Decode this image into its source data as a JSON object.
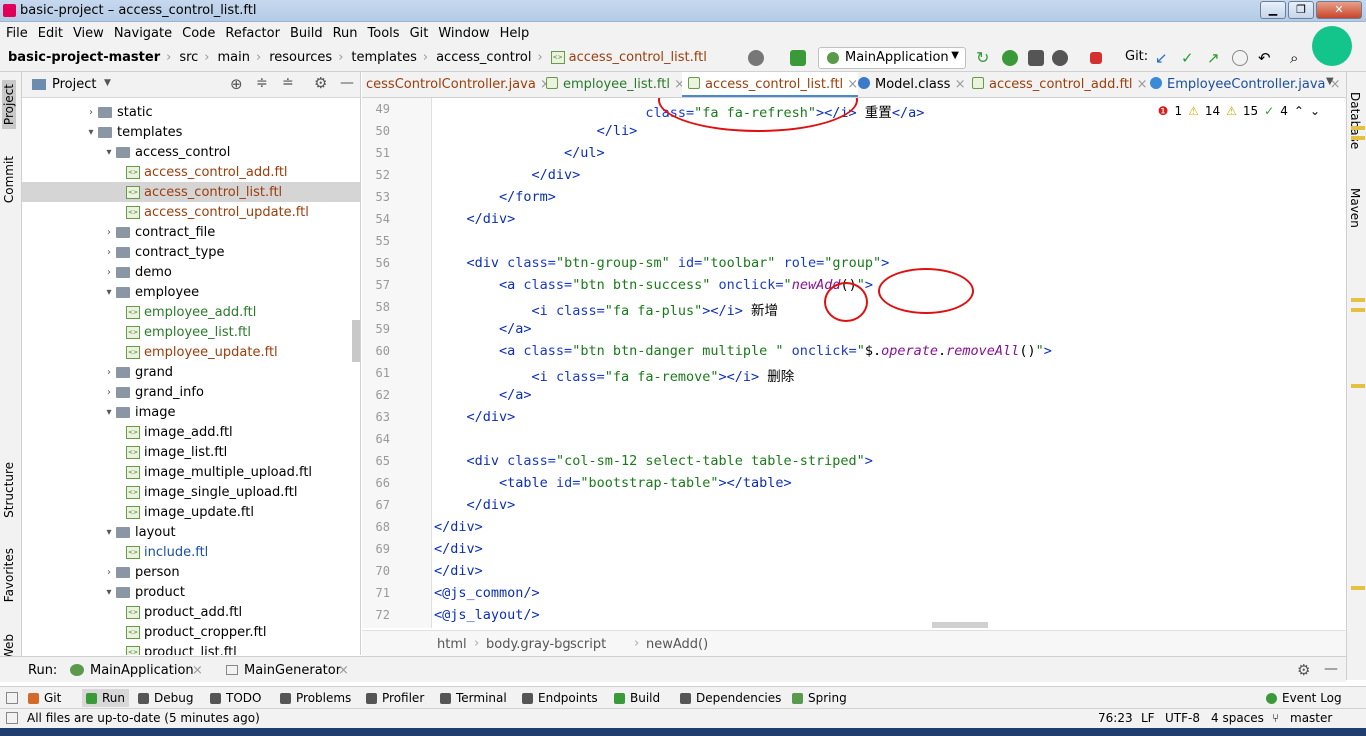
{
  "window": {
    "title": "basic-project – access_control_list.ftl"
  },
  "menu": [
    "File",
    "Edit",
    "View",
    "Navigate",
    "Code",
    "Refactor",
    "Build",
    "Run",
    "Tools",
    "Git",
    "Window",
    "Help"
  ],
  "breadcrumbs": [
    "basic-project-master",
    "src",
    "main",
    "resources",
    "templates",
    "access_control",
    "access_control_list.ftl"
  ],
  "toolbar": {
    "run_config": "MainApplication",
    "git_label": "Git:"
  },
  "project_panel": {
    "title": "Project",
    "tree": [
      {
        "label": "static",
        "type": "folder",
        "depth": 1,
        "expanded": false
      },
      {
        "label": "templates",
        "type": "folder",
        "depth": 1,
        "expanded": true
      },
      {
        "label": "access_control",
        "type": "folder",
        "depth": 2,
        "expanded": true
      },
      {
        "label": "access_control_add.ftl",
        "type": "file",
        "depth": 3,
        "color": "brown"
      },
      {
        "label": "access_control_list.ftl",
        "type": "file",
        "depth": 3,
        "color": "brown",
        "selected": true
      },
      {
        "label": "access_control_update.ftl",
        "type": "file",
        "depth": 3,
        "color": "brown"
      },
      {
        "label": "contract_file",
        "type": "folder",
        "depth": 2,
        "expanded": false
      },
      {
        "label": "contract_type",
        "type": "folder",
        "depth": 2,
        "expanded": false
      },
      {
        "label": "demo",
        "type": "folder",
        "depth": 2,
        "expanded": false
      },
      {
        "label": "employee",
        "type": "folder",
        "depth": 2,
        "expanded": true
      },
      {
        "label": "employee_add.ftl",
        "type": "file",
        "depth": 3,
        "color": "green"
      },
      {
        "label": "employee_list.ftl",
        "type": "file",
        "depth": 3,
        "color": "green"
      },
      {
        "label": "employee_update.ftl",
        "type": "file",
        "depth": 3,
        "color": "brown"
      },
      {
        "label": "grand",
        "type": "folder",
        "depth": 2,
        "expanded": false
      },
      {
        "label": "grand_info",
        "type": "folder",
        "depth": 2,
        "expanded": false
      },
      {
        "label": "image",
        "type": "folder",
        "depth": 2,
        "expanded": true
      },
      {
        "label": "image_add.ftl",
        "type": "file",
        "depth": 3,
        "color": "normal"
      },
      {
        "label": "image_list.ftl",
        "type": "file",
        "depth": 3,
        "color": "normal"
      },
      {
        "label": "image_multiple_upload.ftl",
        "type": "file",
        "depth": 3,
        "color": "normal"
      },
      {
        "label": "image_single_upload.ftl",
        "type": "file",
        "depth": 3,
        "color": "normal"
      },
      {
        "label": "image_update.ftl",
        "type": "file",
        "depth": 3,
        "color": "normal"
      },
      {
        "label": "layout",
        "type": "folder",
        "depth": 2,
        "expanded": true
      },
      {
        "label": "include.ftl",
        "type": "file",
        "depth": 3,
        "color": "blue"
      },
      {
        "label": "person",
        "type": "folder",
        "depth": 2,
        "expanded": false
      },
      {
        "label": "product",
        "type": "folder",
        "depth": 2,
        "expanded": true
      },
      {
        "label": "product_add.ftl",
        "type": "file",
        "depth": 3,
        "color": "normal"
      },
      {
        "label": "product_cropper.ftl",
        "type": "file",
        "depth": 3,
        "color": "normal"
      },
      {
        "label": "product_list.ftl",
        "type": "file",
        "depth": 3,
        "color": "normal"
      }
    ]
  },
  "tabs": [
    {
      "label": "cessControlController.java",
      "color": "brown",
      "active": false
    },
    {
      "label": "employee_list.ftl",
      "color": "green",
      "active": false
    },
    {
      "label": "access_control_list.ftl",
      "color": "brown",
      "active": true
    },
    {
      "label": "Model.class",
      "color": "normal",
      "active": false
    },
    {
      "label": "access_control_add.ftl",
      "color": "brown",
      "active": false
    },
    {
      "label": "EmployeeController.java",
      "color": "blue",
      "active": false
    }
  ],
  "inspections": {
    "errors": "1",
    "warnings": "14",
    "weak": "15",
    "typos": "4"
  },
  "code_lines": [
    {
      "n": "49",
      "html": "                          <span class=\"at\">class=</span><span class=\"vl\">\"fa fa-refresh\"</span><span class=\"tg\">&gt;&lt;/i&gt;</span> 重置<span class=\"tg\">&lt;/a&gt;</span>"
    },
    {
      "n": "50",
      "html": "                    <span class=\"tg\">&lt;/li&gt;</span>"
    },
    {
      "n": "51",
      "html": "                <span class=\"tg\">&lt;/ul&gt;</span>"
    },
    {
      "n": "52",
      "html": "            <span class=\"tg\">&lt;/div&gt;</span>"
    },
    {
      "n": "53",
      "html": "        <span class=\"tg\">&lt;/form&gt;</span>"
    },
    {
      "n": "54",
      "html": "    <span class=\"tg\">&lt;/div&gt;</span>"
    },
    {
      "n": "55",
      "html": ""
    },
    {
      "n": "56",
      "html": "    <span class=\"tg\">&lt;div </span><span class=\"at\">class=</span><span class=\"vl\">\"btn-group-sm\"</span> <span class=\"at\">id=</span><span class=\"vl\">\"toolbar\"</span> <span class=\"at\">role=</span><span class=\"vl\">\"group\"</span><span class=\"tg\">&gt;</span>"
    },
    {
      "n": "57",
      "html": "        <span class=\"tg\">&lt;a </span><span class=\"at\">class=</span><span class=\"vl\">\"btn btn-success\"</span> <span class=\"at\">onclick=</span><span class=\"vl\">\"</span><span class=\"fn\">newAdd</span>()<span class=\"vl\">\"</span><span class=\"tg\">&gt;</span>"
    },
    {
      "n": "58",
      "html": "            <span class=\"tg\">&lt;i </span><span class=\"at\">class=</span><span class=\"vl\">\"fa fa-plus\"</span><span class=\"tg\">&gt;&lt;/i&gt;</span> 新增"
    },
    {
      "n": "59",
      "html": "        <span class=\"tg\">&lt;/a&gt;</span>"
    },
    {
      "n": "60",
      "html": "        <span class=\"tg\">&lt;a </span><span class=\"at\">class=</span><span class=\"vl\">\"btn btn-danger multiple \"</span> <span class=\"at\">onclick=</span><span class=\"vl\">\"</span>$.<span class=\"fn\">operate</span>.<span class=\"fn\">removeAll</span>()<span class=\"vl\">\"</span><span class=\"tg\">&gt;</span>"
    },
    {
      "n": "61",
      "html": "            <span class=\"tg\">&lt;i </span><span class=\"at\">class=</span><span class=\"vl\">\"fa fa-remove\"</span><span class=\"tg\">&gt;&lt;/i&gt;</span> 删除"
    },
    {
      "n": "62",
      "html": "        <span class=\"tg\">&lt;/a&gt;</span>"
    },
    {
      "n": "63",
      "html": "    <span class=\"tg\">&lt;/div&gt;</span>"
    },
    {
      "n": "64",
      "html": ""
    },
    {
      "n": "65",
      "html": "    <span class=\"tg\">&lt;div </span><span class=\"at\">class=</span><span class=\"vl\">\"col-sm-12 select-table table-striped\"</span><span class=\"tg\">&gt;</span>"
    },
    {
      "n": "66",
      "html": "        <span class=\"tg\">&lt;table </span><span class=\"at\">id=</span><span class=\"vl\">\"bootstrap-table\"</span><span class=\"tg\">&gt;&lt;/table&gt;</span>"
    },
    {
      "n": "67",
      "html": "    <span class=\"tg\">&lt;/div&gt;</span>"
    },
    {
      "n": "68",
      "html": "<span class=\"tg\">&lt;/div&gt;</span>"
    },
    {
      "n": "69",
      "html": "<span class=\"tg\">&lt;/div&gt;</span>"
    },
    {
      "n": "70",
      "html": "<span class=\"tg\">&lt;/div&gt;</span>"
    },
    {
      "n": "71",
      "html": "<span class=\"tg\">&lt;@js_common/&gt;</span>"
    },
    {
      "n": "72",
      "html": "<span class=\"tg\">&lt;@js_layout/&gt;</span>"
    }
  ],
  "editor_breadcrumb": [
    "html",
    "body.gray-bg",
    "script",
    "newAdd()"
  ],
  "run_bar": {
    "label": "Run:",
    "tabs": [
      "MainApplication",
      "MainGenerator"
    ]
  },
  "tool_strip": [
    "Git",
    "Run",
    "Debug",
    "TODO",
    "Problems",
    "Profiler",
    "Terminal",
    "Endpoints",
    "Build",
    "Dependencies",
    "Spring"
  ],
  "event_log": "Event Log",
  "status": {
    "message": "All files are up-to-date (5 minutes ago)",
    "position": "76:23",
    "line_sep": "LF",
    "encoding": "UTF-8",
    "indent": "4 spaces",
    "branch": "master"
  },
  "side_tabs_left": [
    "Project",
    "Commit",
    "Structure",
    "Favorites",
    "Web"
  ],
  "side_tabs_right": [
    "Database",
    "Maven"
  ],
  "colors": {
    "accent": "#4a88d0",
    "annotation": "#e01010"
  }
}
